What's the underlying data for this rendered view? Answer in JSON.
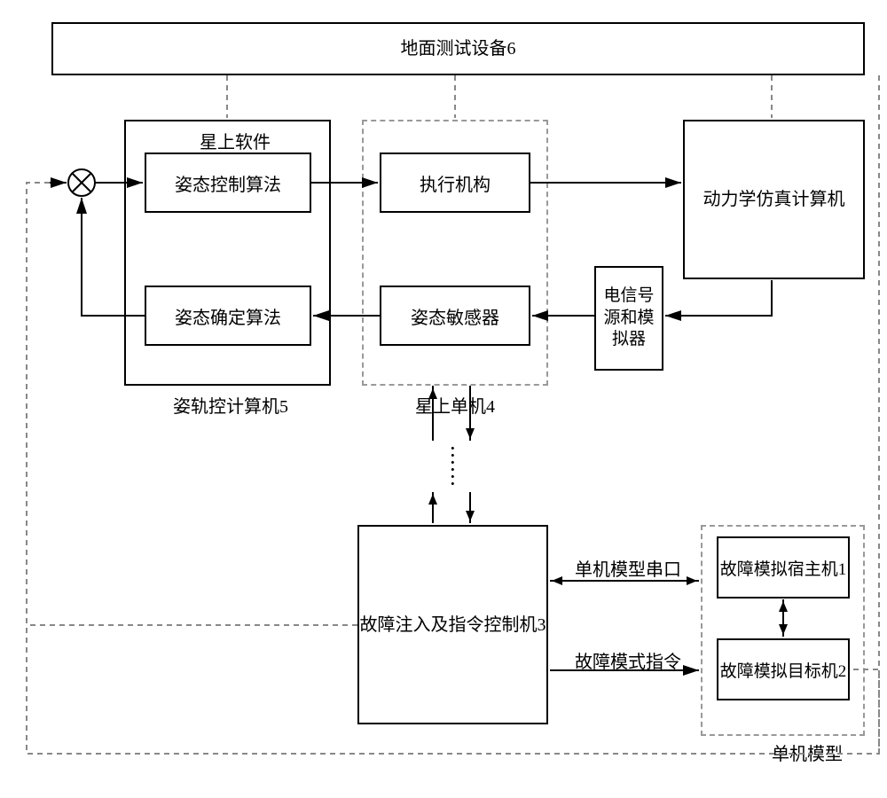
{
  "top_bar": "地面测试设备6",
  "onboard_sw_label": "星上软件",
  "attitude_ctrl_algo": "姿态控制算法",
  "attitude_det_algo": "姿态确定算法",
  "aoc_computer_label": "姿轨控计算机5",
  "actuator": "执行机构",
  "attitude_sensor": "姿态敏感器",
  "onboard_unit_label": "星上单机4",
  "dynamics_sim": "动力学仿真计算机",
  "signal_sim": "电信号源和模拟器",
  "fault_ctrl": "故障注入及指令控制机3",
  "unit_model_serial": "单机模型串口",
  "fault_mode_cmd": "故障模式指令",
  "fault_sim_host": "故障模拟宿主机1",
  "fault_sim_target": "故障模拟目标机2",
  "unit_model_label": "单机模型"
}
